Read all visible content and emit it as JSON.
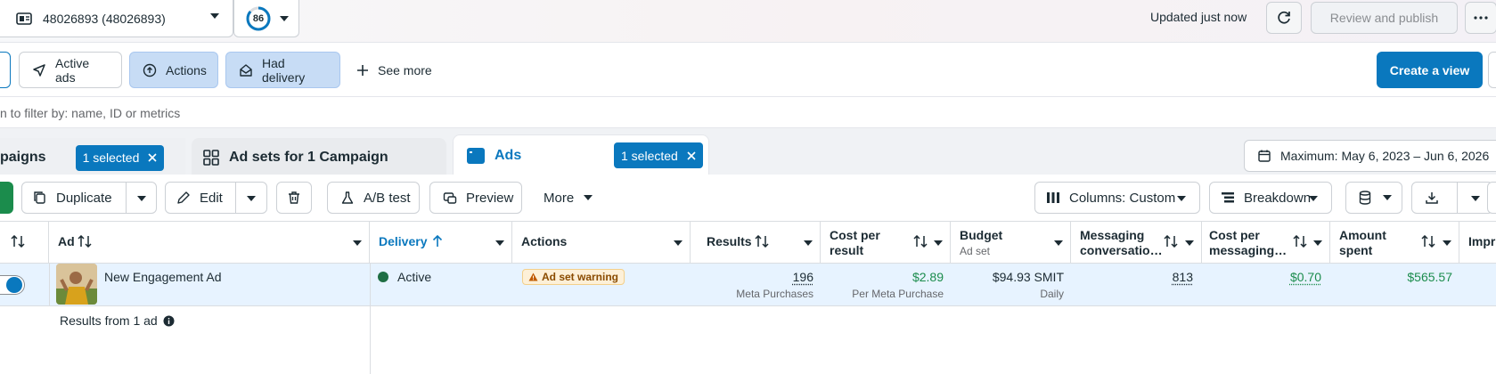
{
  "topbar": {
    "account_label": "48026893 (48026893)",
    "score": "86",
    "updated": "Updated just now",
    "review_label": "Review and publish"
  },
  "filters": {
    "chips": [
      "Active ads",
      "Actions",
      "Had delivery"
    ],
    "see_more": "See more",
    "create_view": "Create a view"
  },
  "search": {
    "placeholder": "n to filter by: name, ID or metrics"
  },
  "tabs": {
    "campaigns": "paigns",
    "campaigns_selected": "1 selected",
    "adsets": "Ad sets for 1 Campaign",
    "ads": "Ads",
    "ads_selected": "1 selected"
  },
  "date_range": "Maximum: May 6, 2023 – Jun 6, 2026",
  "toolbar": {
    "duplicate": "Duplicate",
    "edit": "Edit",
    "ab_test": "A/B test",
    "preview": "Preview",
    "more": "More",
    "columns": "Columns: Custom",
    "breakdown": "Breakdown"
  },
  "table": {
    "headers": {
      "ad": "Ad",
      "delivery": "Delivery",
      "actions": "Actions",
      "results": "Results",
      "cost_per_result_1": "Cost per",
      "cost_per_result_2": "result",
      "budget": "Budget",
      "budget_sub": "Ad set",
      "messaging_1": "Messaging",
      "messaging_2": "conversatio…",
      "cost_msg_1": "Cost per",
      "cost_msg_2": "messaging…",
      "amount_1": "Amount",
      "amount_2": "spent",
      "impressions": "Impr"
    },
    "row": {
      "ad_name": "New Engagement Ad",
      "delivery": "Active",
      "actions_badge": "Ad set warning",
      "results": "196",
      "results_sub": "Meta Purchases",
      "cost_per_result": "$2.89",
      "cost_per_result_sub": "Per Meta Purchase",
      "budget": "$94.93 SMIT",
      "budget_sub": "Daily",
      "messaging": "813",
      "cost_msg": "$0.70",
      "amount_spent": "$565.57"
    },
    "footer": "Results from 1 ad"
  },
  "colors": {
    "accent": "#0a78be",
    "success": "#1b8c4c",
    "selected_row": "#e7f3ff"
  }
}
